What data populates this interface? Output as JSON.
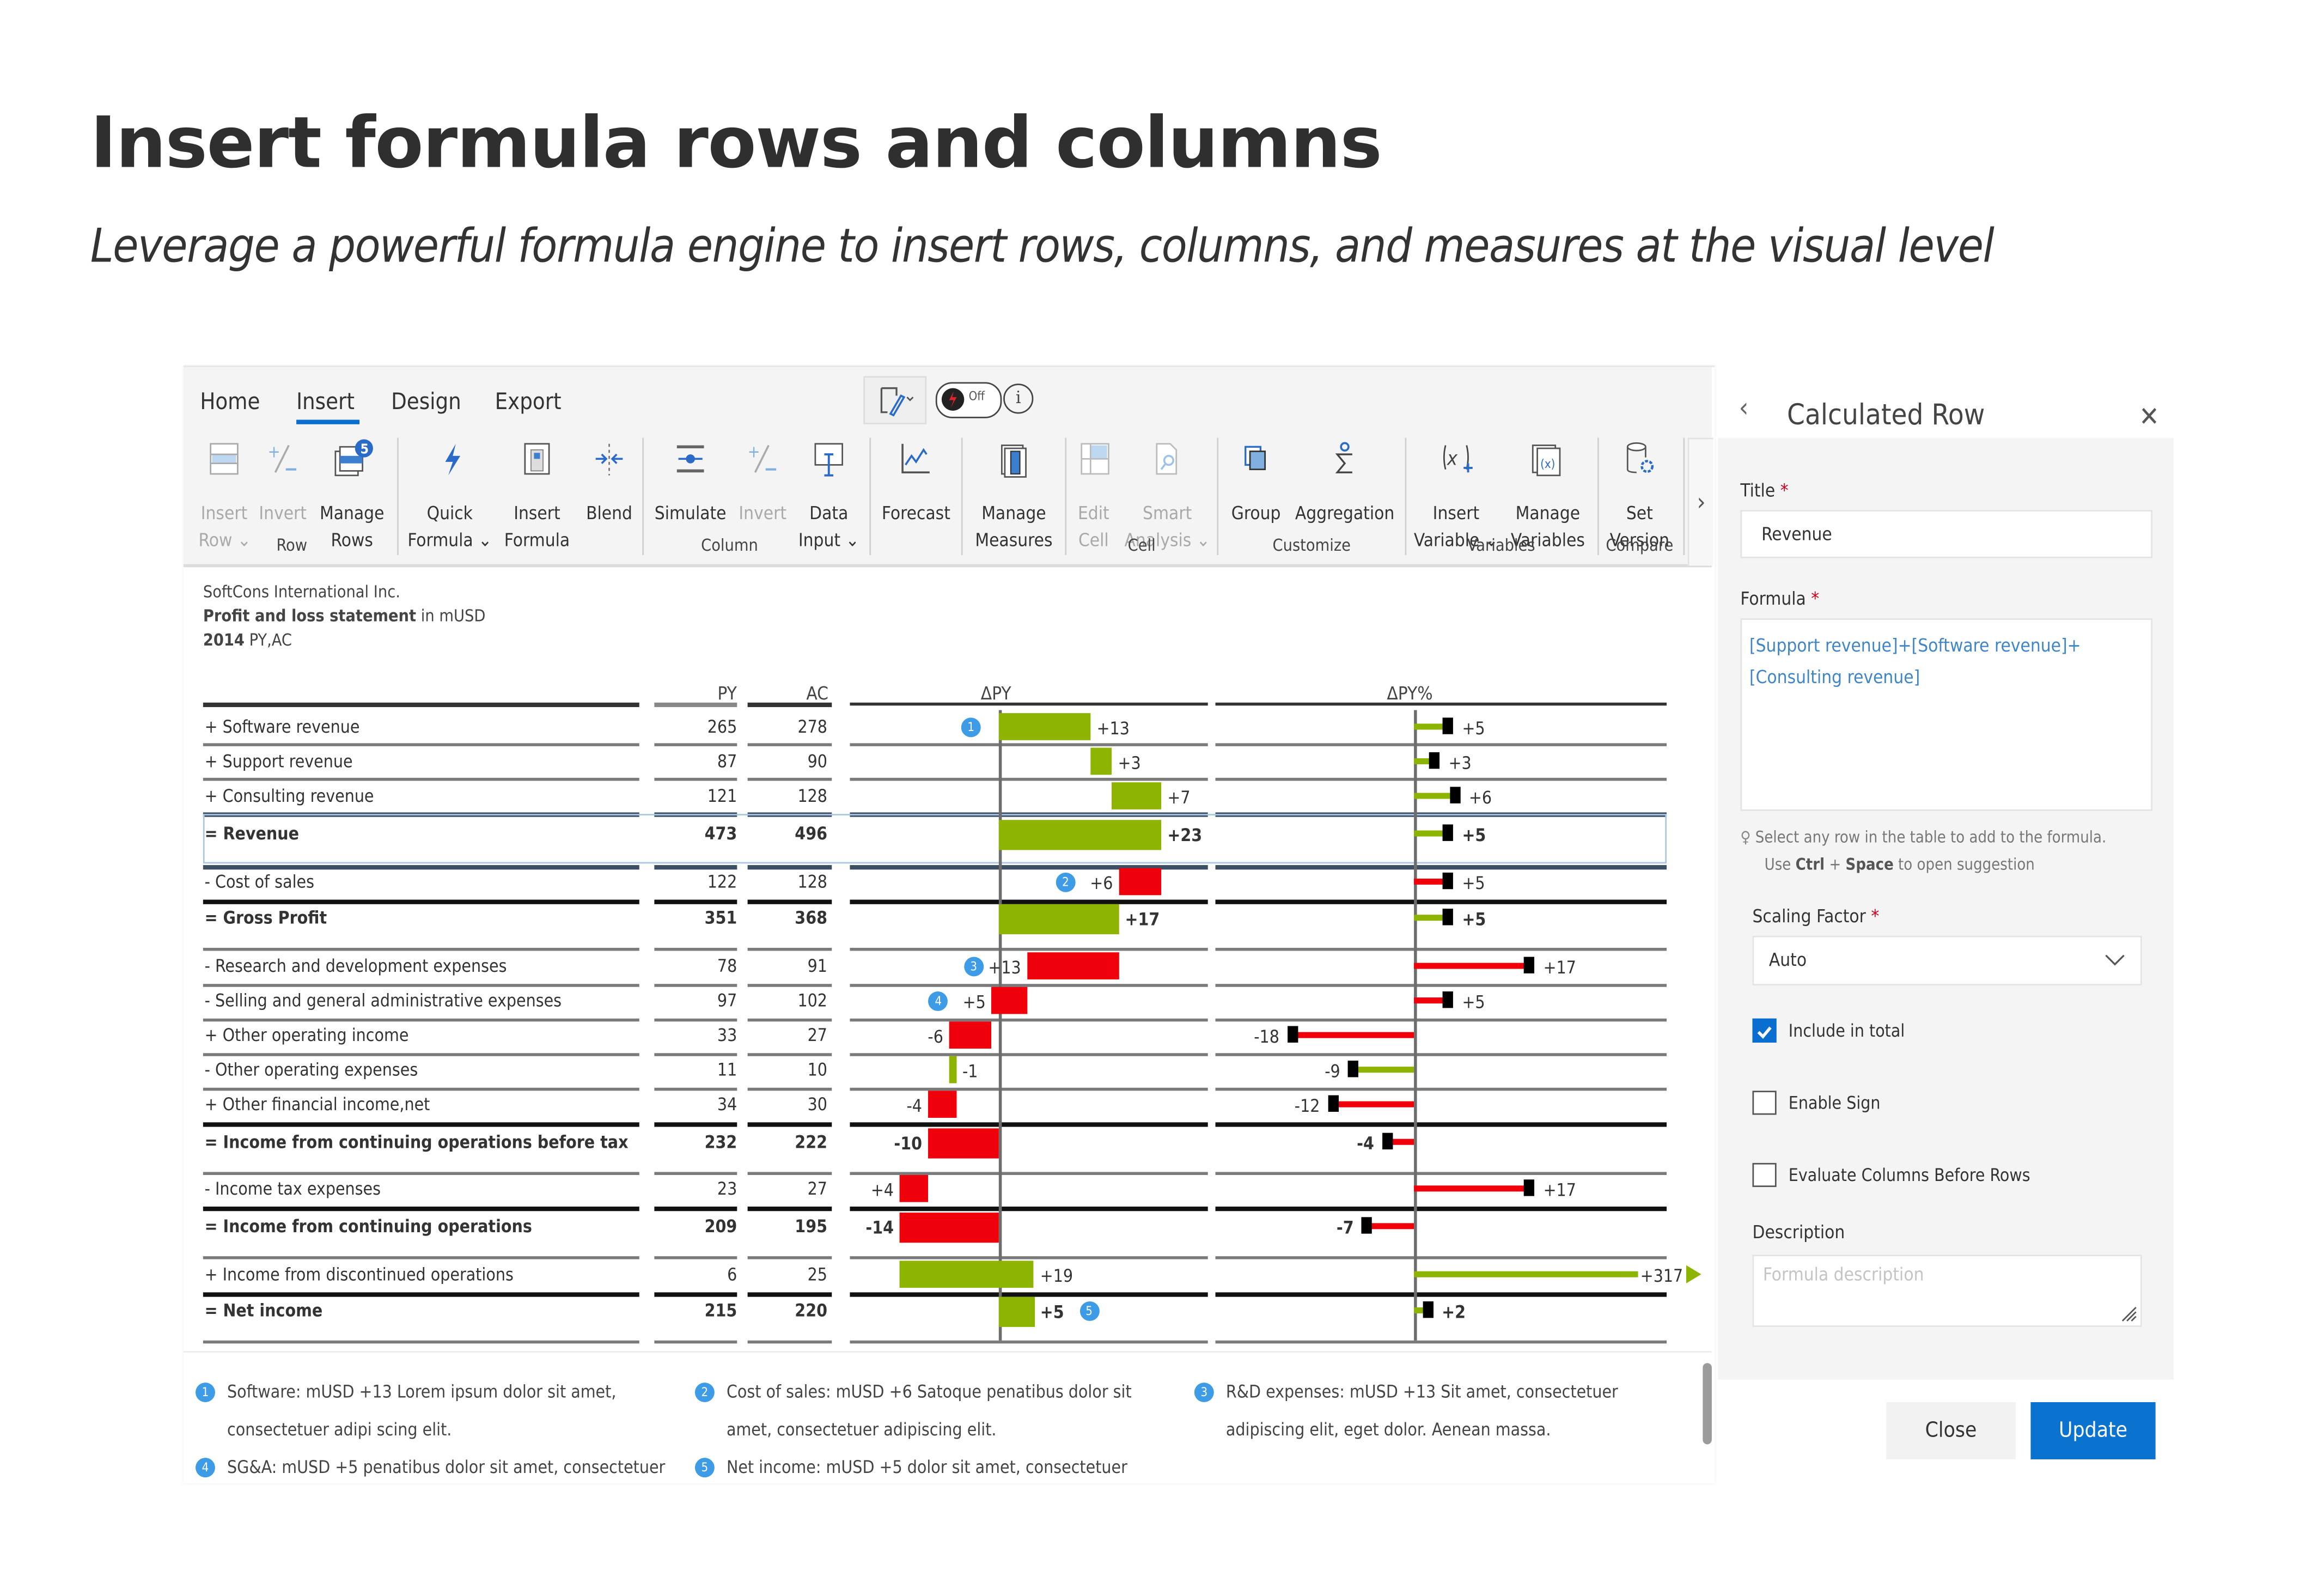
{
  "header": {
    "title": "Insert formula rows and columns",
    "subtitle": "Leverage a powerful formula engine to insert rows, columns, and measures at the visual level"
  },
  "ribbon": {
    "tabs": [
      {
        "label": "Home",
        "active": false
      },
      {
        "label": "Insert",
        "active": true
      },
      {
        "label": "Design",
        "active": false
      },
      {
        "label": "Export",
        "active": false
      }
    ],
    "toggle_label": "Off",
    "manage_rows_badge": "5",
    "buttons": {
      "insert_row": {
        "l1": "Insert",
        "l2": "Row",
        "disabled": true,
        "dropdown": true
      },
      "invert_row": {
        "l1": "Invert",
        "l2": "",
        "disabled": true
      },
      "manage_rows": {
        "l1": "Manage",
        "l2": "Rows"
      },
      "quick_formula": {
        "l1": "Quick",
        "l2": "Formula",
        "dropdown": true
      },
      "insert_formula": {
        "l1": "Insert",
        "l2": "Formula"
      },
      "blend": {
        "l1": "Blend",
        "l2": ""
      },
      "simulate": {
        "l1": "Simulate",
        "l2": ""
      },
      "invert_col": {
        "l1": "Invert",
        "l2": "",
        "disabled": true
      },
      "data_input": {
        "l1": "Data",
        "l2": "Input",
        "dropdown": true
      },
      "forecast": {
        "l1": "Forecast",
        "l2": ""
      },
      "manage_measures": {
        "l1": "Manage",
        "l2": "Measures"
      },
      "edit_cell": {
        "l1": "Edit",
        "l2": "Cell",
        "disabled": true
      },
      "smart_analysis": {
        "l1": "Smart",
        "l2": "Analysis",
        "disabled": true,
        "dropdown": true
      },
      "group": {
        "l1": "Group",
        "l2": ""
      },
      "aggregation": {
        "l1": "Aggregation",
        "l2": ""
      },
      "insert_variable": {
        "l1": "Insert",
        "l2": "Variable",
        "dropdown": true
      },
      "manage_variables": {
        "l1": "Manage",
        "l2": "Variables"
      },
      "set_version": {
        "l1": "Set",
        "l2": "Version"
      }
    },
    "groups": {
      "row": "Row",
      "column": "Column",
      "cell": "Cell",
      "customize": "Customize",
      "variables": "Variables",
      "compare": "Compare"
    }
  },
  "statement": {
    "company": "SoftCons International Inc.",
    "title_bold": "Profit and loss statement",
    "title_rest": " in mUSD",
    "period_bold": "2014",
    "period_rest": " PY,AC",
    "columns": {
      "py": "PY",
      "ac": "AC",
      "dpy": "ΔPY",
      "dpy_pct": "ΔPY%"
    },
    "rows": [
      {
        "sign": "+",
        "label": "Software revenue",
        "py": "265",
        "ac": "278",
        "dpy": 13,
        "dpy_label": "+13",
        "pct": 5,
        "pct_label": "+5",
        "bold": false,
        "badge": "1"
      },
      {
        "sign": "+",
        "label": "Support revenue",
        "py": "87",
        "ac": "90",
        "dpy": 3,
        "dpy_label": "+3",
        "pct": 3,
        "pct_label": "+3",
        "bold": false
      },
      {
        "sign": "+",
        "label": "Consulting revenue",
        "py": "121",
        "ac": "128",
        "dpy": 7,
        "dpy_label": "+7",
        "pct": 6,
        "pct_label": "+6",
        "bold": false
      },
      {
        "sign": "=",
        "label": "Revenue",
        "py": "473",
        "ac": "496",
        "dpy": 23,
        "dpy_label": "+23",
        "pct": 5,
        "pct_label": "+5",
        "bold": true,
        "selected": true
      },
      {
        "sign": "-",
        "label": "Cost of sales",
        "py": "122",
        "ac": "128",
        "dpy": 6,
        "dpy_label": "+6",
        "pct": 5,
        "pct_label": "+5",
        "bold": false,
        "badge": "2",
        "cost": true
      },
      {
        "sign": "=",
        "label": "Gross Profit",
        "py": "351",
        "ac": "368",
        "dpy": 17,
        "dpy_label": "+17",
        "pct": 5,
        "pct_label": "+5",
        "bold": true
      },
      {
        "sign": "-",
        "label": "Research and development expenses",
        "py": "78",
        "ac": "91",
        "dpy": 13,
        "dpy_label": "+13",
        "pct": 17,
        "pct_label": "+17",
        "bold": false,
        "badge": "3",
        "cost": true
      },
      {
        "sign": "-",
        "label": "Selling and general administrative expenses",
        "py": "97",
        "ac": "102",
        "dpy": 5,
        "dpy_label": "+5",
        "pct": 5,
        "pct_label": "+5",
        "bold": false,
        "badge": "4",
        "cost": true
      },
      {
        "sign": "+",
        "label": "Other operating income",
        "py": "33",
        "ac": "27",
        "dpy": -6,
        "dpy_label": "-6",
        "pct": -18,
        "pct_label": "-18",
        "bold": false
      },
      {
        "sign": "-",
        "label": "Other operating expenses",
        "py": "11",
        "ac": "10",
        "dpy": -1,
        "dpy_label": "-1",
        "pct": -9,
        "pct_label": "-9",
        "bold": false,
        "cost": true
      },
      {
        "sign": "+",
        "label": "Other financial income,net",
        "py": "34",
        "ac": "30",
        "dpy": -4,
        "dpy_label": "-4",
        "pct": -12,
        "pct_label": "-12",
        "bold": false
      },
      {
        "sign": "=",
        "label": "Income from continuing operations before tax",
        "py": "232",
        "ac": "222",
        "dpy": -10,
        "dpy_label": "-10",
        "pct": -4,
        "pct_label": "-4",
        "bold": true
      },
      {
        "sign": "-",
        "label": "Income tax expenses",
        "py": "23",
        "ac": "27",
        "dpy": 4,
        "dpy_label": "+4",
        "pct": 17,
        "pct_label": "+17",
        "bold": false,
        "cost": true
      },
      {
        "sign": "=",
        "label": "Income from continuing operations",
        "py": "209",
        "ac": "195",
        "dpy": -14,
        "dpy_label": "-14",
        "pct": -7,
        "pct_label": "-7",
        "bold": true
      },
      {
        "sign": "+",
        "label": "Income from discontinued operations",
        "py": "6",
        "ac": "25",
        "dpy": 19,
        "dpy_label": "+19",
        "pct": 317,
        "pct_label": "+317",
        "bold": false,
        "clipped": true
      },
      {
        "sign": "=",
        "label": "Net income",
        "py": "215",
        "ac": "220",
        "dpy": 5,
        "dpy_label": "+5",
        "pct": 2,
        "pct_label": "+2",
        "bold": true,
        "badge": "5"
      }
    ]
  },
  "notes": [
    {
      "n": "1",
      "l1": "Software: mUSD +13 Lorem ipsum dolor sit amet,",
      "l2": "consectetuer adipi scing elit."
    },
    {
      "n": "2",
      "l1": "Cost of sales: mUSD +6 Satoque penatibus dolor sit",
      "l2": "amet, consectetuer adipiscing elit."
    },
    {
      "n": "3",
      "l1": "R&D expenses: mUSD +13 Sit amet, consectetuer",
      "l2": "adipiscing elit, eget dolor. Aenean massa."
    },
    {
      "n": "4",
      "l1": "SG&A: mUSD +5 penatibus dolor sit amet, consectetuer",
      "l2": ""
    },
    {
      "n": "5",
      "l1": "Net income: mUSD +5 dolor sit amet, consectetuer",
      "l2": ""
    }
  ],
  "panel": {
    "title": "Calculated Row",
    "title_label": "Title",
    "title_value": "Revenue",
    "formula_label": "Formula",
    "formula_value": "[Support revenue]+[Software revenue]+[Consulting revenue]",
    "hint_l1": "Select any row in the table to add to the formula.",
    "hint_use": "Use ",
    "hint_ctrl": "Ctrl",
    "hint_plus": " + ",
    "hint_space": "Space",
    "hint_rest": " to open suggestion",
    "scaling_label": "Scaling Factor",
    "scaling_value": "Auto",
    "include_total": {
      "label": "Include in total",
      "checked": true
    },
    "enable_sign": {
      "label": "Enable Sign",
      "checked": false
    },
    "eval_cols": {
      "label": "Evaluate Columns Before Rows",
      "checked": false
    },
    "description_label": "Description",
    "description_placeholder": "Formula description",
    "close_label": "Close",
    "update_label": "Update"
  },
  "colors": {
    "positive": "#8cb400",
    "negative": "#f0000a",
    "accent": "#0a6ed1",
    "badge": "#3e9be6"
  }
}
